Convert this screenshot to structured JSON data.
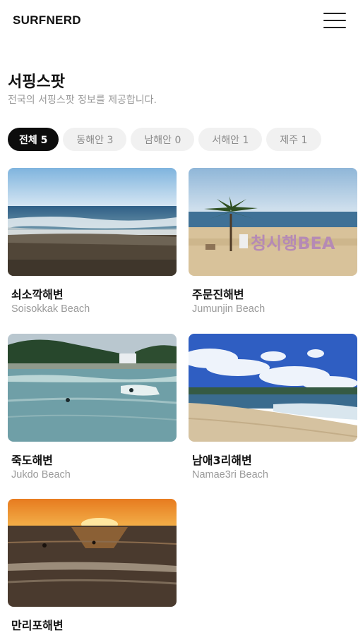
{
  "header": {
    "logo": "SURFNERD",
    "menu_icon": "hamburger-menu-icon"
  },
  "page": {
    "title": "서핑스팟",
    "subtitle": "전국의 서핑스팟 정보를 제공합니다."
  },
  "filters": [
    {
      "label": "전체 5",
      "active": true
    },
    {
      "label": "동해안 3",
      "active": false
    },
    {
      "label": "남해안 0",
      "active": false
    },
    {
      "label": "서해안 1",
      "active": false
    },
    {
      "label": "제주 1",
      "active": false
    }
  ],
  "spots": [
    {
      "name_ko": "쇠소깍해변",
      "name_en": "Soisokkak Beach",
      "image": "beach-photo-soisokkak"
    },
    {
      "name_ko": "주문진해변",
      "name_en": "Jumunjin Beach",
      "image": "beach-photo-jumunjin",
      "sign_text": "청시행BEA"
    },
    {
      "name_ko": "죽도해변",
      "name_en": "Jukdo Beach",
      "image": "beach-photo-jukdo"
    },
    {
      "name_ko": "남애3리해변",
      "name_en": "Namae3ri Beach",
      "image": "beach-photo-namae"
    },
    {
      "name_ko": "만리포해변",
      "name_en": "",
      "image": "beach-photo-mallipo-sunset"
    }
  ]
}
